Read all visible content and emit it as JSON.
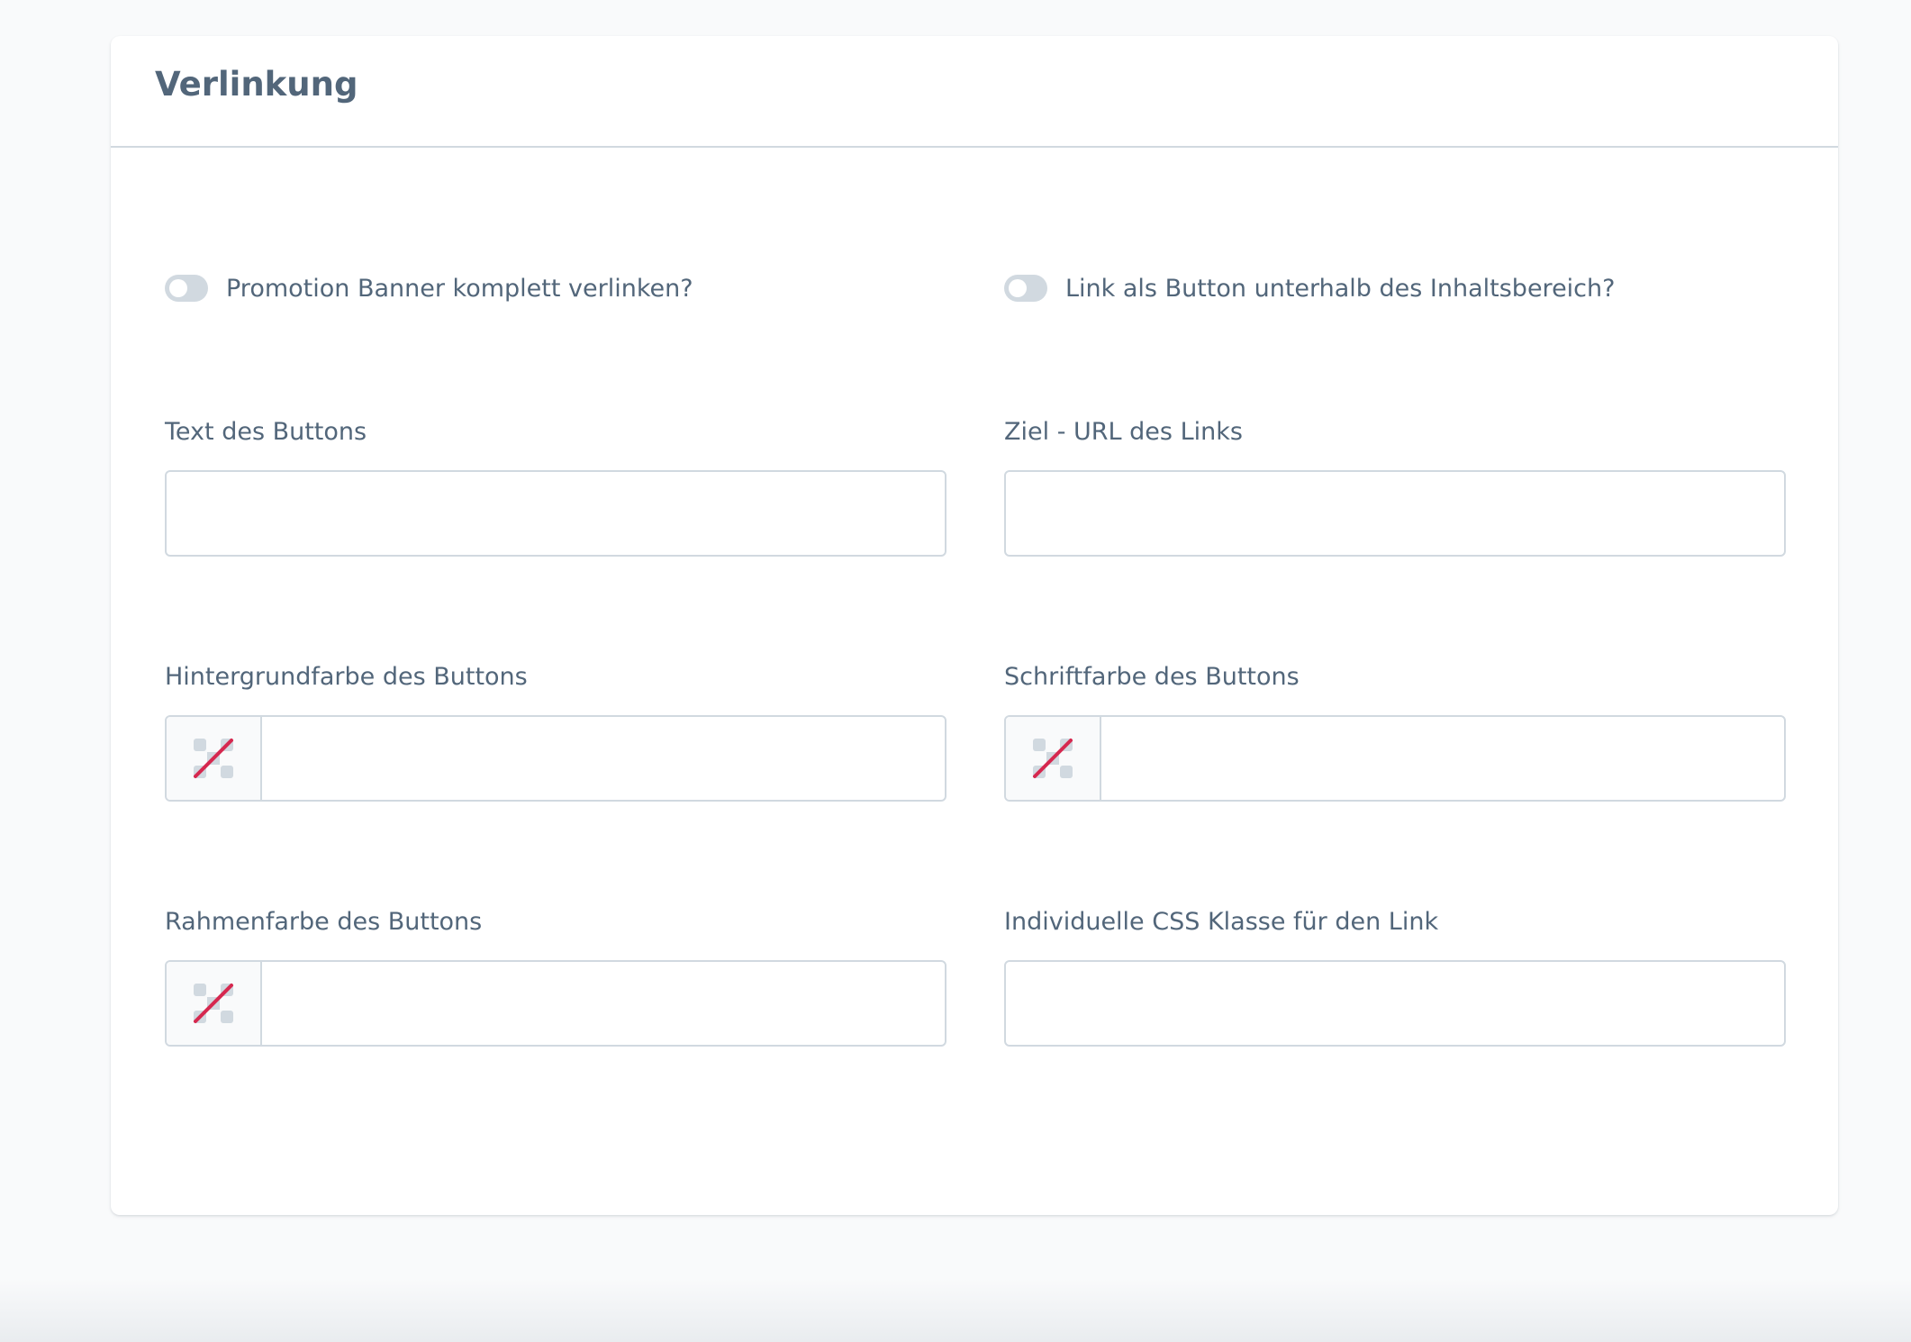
{
  "card": {
    "title": "Verlinkung"
  },
  "switches": {
    "full_banner_link": {
      "label": "Promotion Banner komplett verlinken?",
      "checked": false
    },
    "button_below_content": {
      "label": "Link als Button unterhalb des Inhaltsbereich?",
      "checked": false
    }
  },
  "fields": {
    "button_text": {
      "label": "Text des Buttons",
      "value": ""
    },
    "target_url": {
      "label": "Ziel - URL des Links",
      "value": ""
    },
    "button_bg_color": {
      "label": "Hintergrundfarbe des Buttons",
      "value": "",
      "icon": "no-color-icon"
    },
    "button_font_color": {
      "label": "Schriftfarbe des Buttons",
      "value": "",
      "icon": "no-color-icon"
    },
    "button_border_color": {
      "label": "Rahmenfarbe des Buttons",
      "value": "",
      "icon": "no-color-icon"
    },
    "custom_css_class": {
      "label": "Individuelle CSS Klasse für den Link",
      "value": ""
    }
  },
  "colors": {
    "text": "#52667a",
    "border": "#d1d9e0",
    "toggle_off": "#d1d9e0",
    "no_color_slash": "#d6284f",
    "page_background": "#f9fafb"
  }
}
